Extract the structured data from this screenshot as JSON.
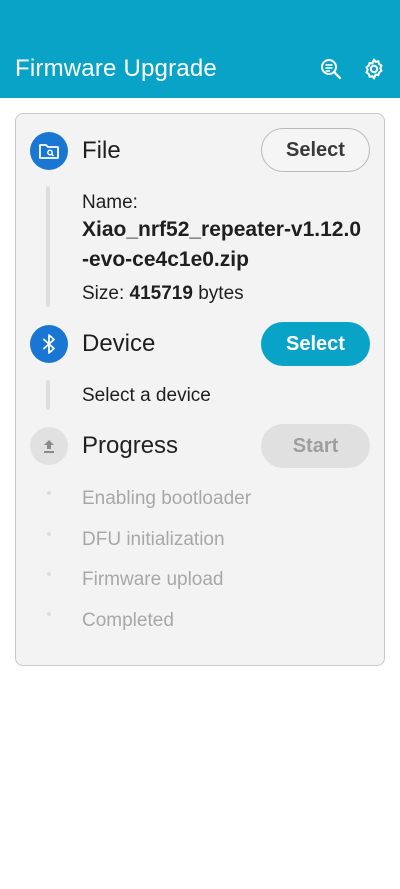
{
  "appbar": {
    "title": "Firmware Upgrade",
    "icons": [
      "search-log-icon",
      "settings-gear-icon"
    ]
  },
  "file_step": {
    "title": "File",
    "button_label": "Select",
    "name_label": "Name:",
    "file_name_line1": "Xiao_nrf52_repeater-v1.12.0",
    "file_name_line2": "-evo-ce4c1e0.zip",
    "size_label": "Size:",
    "size_value": "415719",
    "size_unit": "bytes",
    "icon": "folder-icon"
  },
  "device_step": {
    "title": "Device",
    "button_label": "Select",
    "status": "Select a device",
    "icon": "bluetooth-icon"
  },
  "progress_step": {
    "title": "Progress",
    "button_label": "Start",
    "icon": "upload-icon",
    "stages": [
      "Enabling bootloader",
      "DFU initialization",
      "Firmware upload",
      "Completed"
    ]
  },
  "colors": {
    "accent": "#0aa3c8",
    "active_step": "#1976d2",
    "disabled": "#e0e0e0"
  }
}
